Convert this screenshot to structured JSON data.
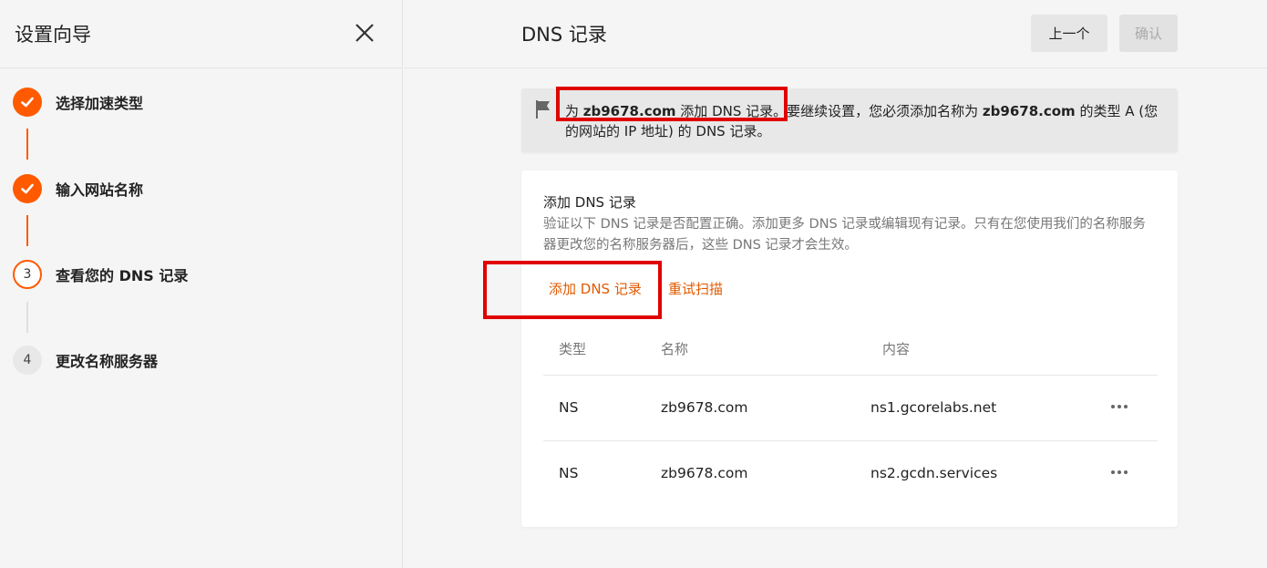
{
  "sidebar": {
    "title": "设置向导",
    "steps": [
      {
        "number": "",
        "label": "选择加速类型",
        "state": "done"
      },
      {
        "number": "",
        "label": "输入网站名称",
        "state": "done"
      },
      {
        "number": "3",
        "label": "查看您的 DNS 记录",
        "state": "current"
      },
      {
        "number": "4",
        "label": "更改名称服务器",
        "state": "todo"
      }
    ]
  },
  "header": {
    "title": "DNS 记录",
    "prev_label": "上一个",
    "confirm_label": "确认"
  },
  "notice": {
    "part1": "为 ",
    "domain": "zb9678.com",
    "part2": " 添加 DNS 记录。",
    "part3": "要继续设置，您必须添加名称为 ",
    "domain2": "zb9678.com",
    "part4": " 的类型 A (您的网站的 IP 地址) 的 DNS 记录。"
  },
  "card": {
    "title": "添加 DNS 记录",
    "description": "验证以下 DNS 记录是否配置正确。添加更多 DNS 记录或编辑现有记录。只有在您使用我们的名称服务器更改您的名称服务器后，这些 DNS 记录才会生效。",
    "add_link": "添加 DNS 记录",
    "rescan_link": "重试扫描",
    "columns": [
      "类型",
      "名称",
      "内容"
    ],
    "rows": [
      {
        "type": "NS",
        "name": "zb9678.com",
        "content": "ns1.gcorelabs.net"
      },
      {
        "type": "NS",
        "name": "zb9678.com",
        "content": "ns2.gcdn.services"
      }
    ]
  },
  "colors": {
    "accent": "#ff5a00",
    "link": "#e05a00",
    "highlight": "#e00000"
  }
}
